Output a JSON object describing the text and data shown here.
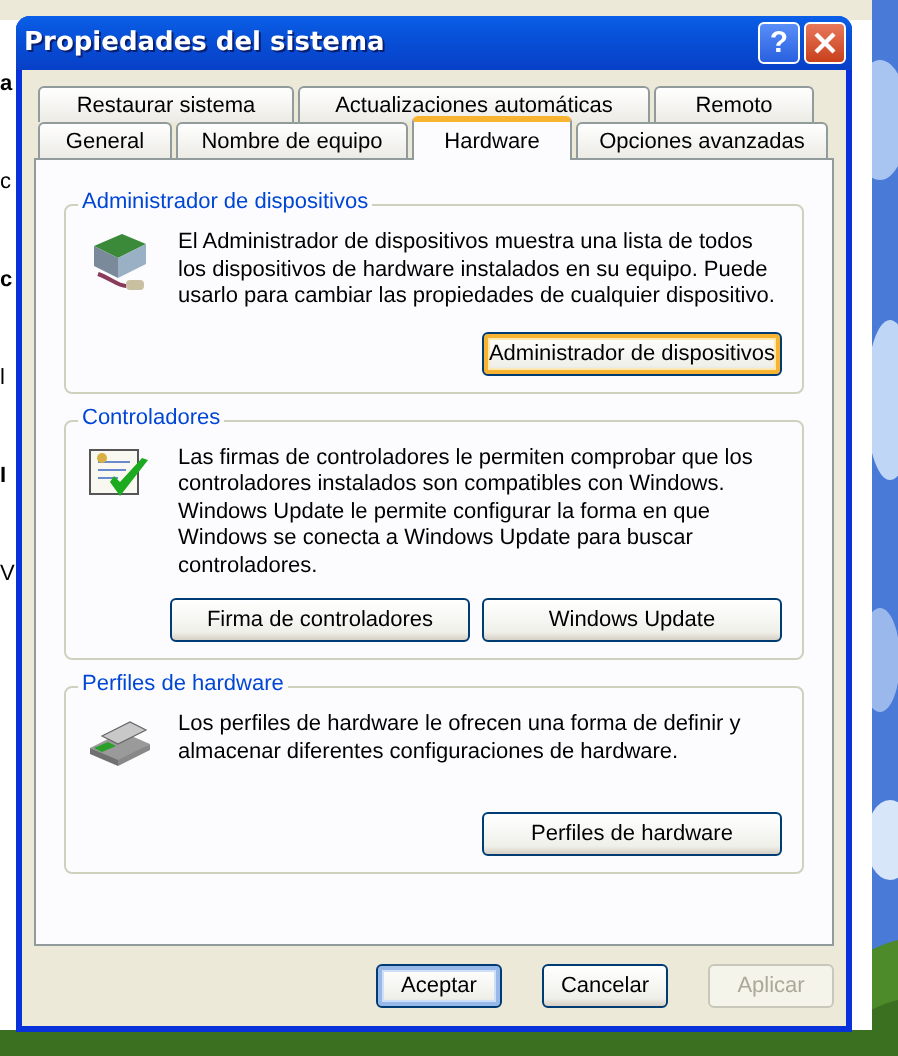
{
  "background_window": {
    "fragments": [
      {
        "text": "a",
        "bold": true
      },
      {
        "text": "c",
        "bold": false
      },
      {
        "text": "c",
        "bold": true
      },
      {
        "text": "l",
        "bold": false
      },
      {
        "text": "I",
        "bold": true
      },
      {
        "text": "V",
        "bold": false
      }
    ]
  },
  "window": {
    "title": "Propiedades del sistema",
    "help_button": "?"
  },
  "tabs": {
    "back_row": [
      {
        "label": "Restaurar sistema",
        "selected": false
      },
      {
        "label": "Actualizaciones automáticas",
        "selected": false
      },
      {
        "label": "Remoto",
        "selected": false
      }
    ],
    "front_row": [
      {
        "label": "General",
        "selected": false
      },
      {
        "label": "Nombre de equipo",
        "selected": false
      },
      {
        "label": "Hardware",
        "selected": true
      },
      {
        "label": "Opciones avanzadas",
        "selected": false
      }
    ]
  },
  "groups": [
    {
      "title": "Administrador de dispositivos",
      "description": "El Administrador de dispositivos muestra una lista de todos los dispositivos de hardware instalados en su equipo. Puede usarlo para cambiar las propiedades de cualquier dispositivo.",
      "buttons": [
        {
          "label": "Administrador de dispositivos",
          "focused": true
        }
      ]
    },
    {
      "title": "Controladores",
      "description": "Las firmas de controladores le permiten comprobar que los controladores instalados son compatibles con Windows. Windows Update le permite configurar la forma en que Windows se conecta a Windows Update para buscar controladores.",
      "buttons": [
        {
          "label": "Firma de controladores",
          "focused": false
        },
        {
          "label": "Windows Update",
          "focused": false
        }
      ]
    },
    {
      "title": "Perfiles de hardware",
      "description": "Los perfiles de hardware le ofrecen una forma de definir y almacenar diferentes configuraciones de hardware.",
      "buttons": [
        {
          "label": "Perfiles de hardware",
          "focused": false
        }
      ]
    }
  ],
  "dialog_buttons": [
    {
      "label": "Aceptar",
      "default": true,
      "disabled": false
    },
    {
      "label": "Cancelar",
      "default": false,
      "disabled": false
    },
    {
      "label": "Aplicar",
      "default": false,
      "disabled": true
    }
  ]
}
